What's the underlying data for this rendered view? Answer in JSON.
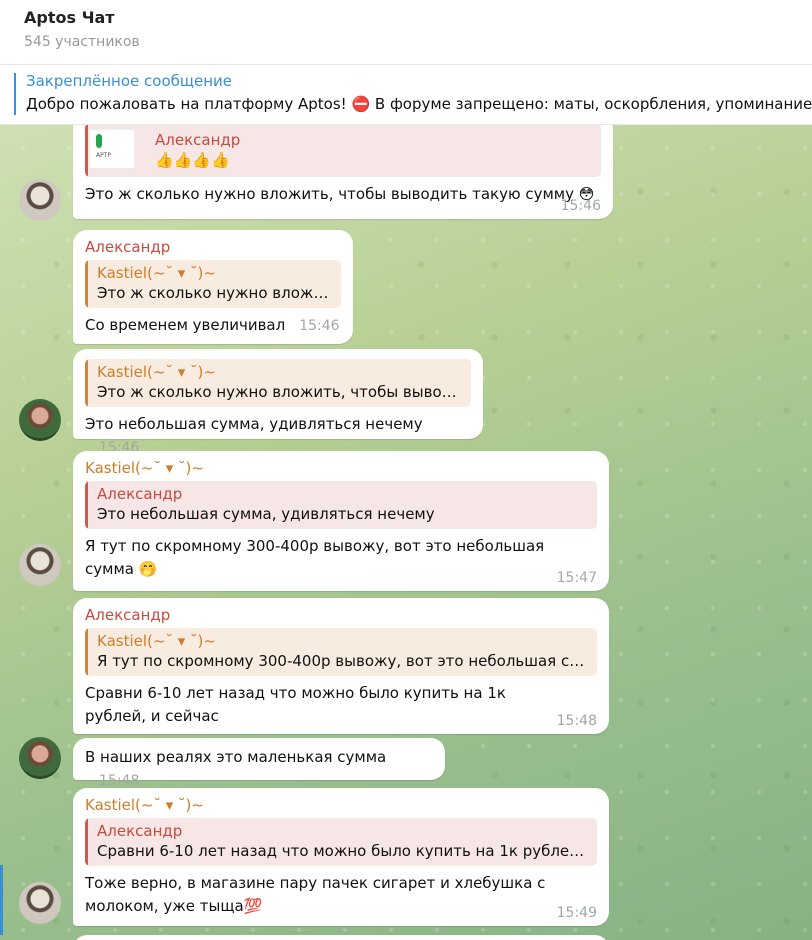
{
  "header": {
    "title": "Aptos Чат",
    "subtitle": "545 участников"
  },
  "pinned": {
    "label": "Закреплённое сообщение",
    "text": "Добро пожаловать на платформу Aptos! ⛔ В форуме запрещено: маты, оскорбления, упоминание"
  },
  "messages": [
    {
      "reply_name": "Александр",
      "reply_text": "👍👍👍👍",
      "reply_thumb_text": "APTP",
      "text": "Это ж сколько нужно вложить, чтобы выводить такую сумму 😳",
      "time": "15:46"
    },
    {
      "sender": "Александр",
      "reply_name": "Kastiel(~˘ ▾ ˘)~",
      "reply_text": "Это ж сколько нужно вложи...",
      "text": "Со временем увеличивал",
      "time": "15:46"
    },
    {
      "reply_name": "Kastiel(~˘ ▾ ˘)~",
      "reply_text": "Это ж сколько нужно вложить, чтобы вывод...",
      "text": "Это небольшая сумма, удивляться нечему",
      "time": "15:46"
    },
    {
      "sender": "Kastiel(~˘ ▾ ˘)~",
      "reply_name": "Александр",
      "reply_text": "Это небольшая сумма, удивляться нечему",
      "text": "Я тут по скромному 300-400р вывожу, вот это небольшая сумма 🤭",
      "time": "15:47"
    },
    {
      "sender": "Александр",
      "reply_name": "Kastiel(~˘ ▾ ˘)~",
      "reply_text": "Я тут по скромному 300-400р вывожу, вот это небольшая су...",
      "text": "Сравни 6-10 лет назад что можно было купить на 1к рублей, и сейчас",
      "time": "15:48"
    },
    {
      "text": "В наших реалях это маленькая сумма",
      "time": "15:48"
    },
    {
      "sender": "Kastiel(~˘ ▾ ˘)~",
      "reply_name": "Александр",
      "reply_text": "Сравни 6-10 лет назад что можно было купить на 1к рублей, ...",
      "text": "Тоже верно, в магазине пару пачек сигарет и хлебушка с молоком, уже тыща💯",
      "time": "15:49"
    }
  ],
  "avatars": {
    "kastiel": "user-avatar-kastiel",
    "alexander": "user-avatar-alexander"
  },
  "colors": {
    "link": "#3a8fd1",
    "name_red": "#c64a3f",
    "name_orange": "#cf7d2c",
    "time": "#a0a9a3"
  }
}
